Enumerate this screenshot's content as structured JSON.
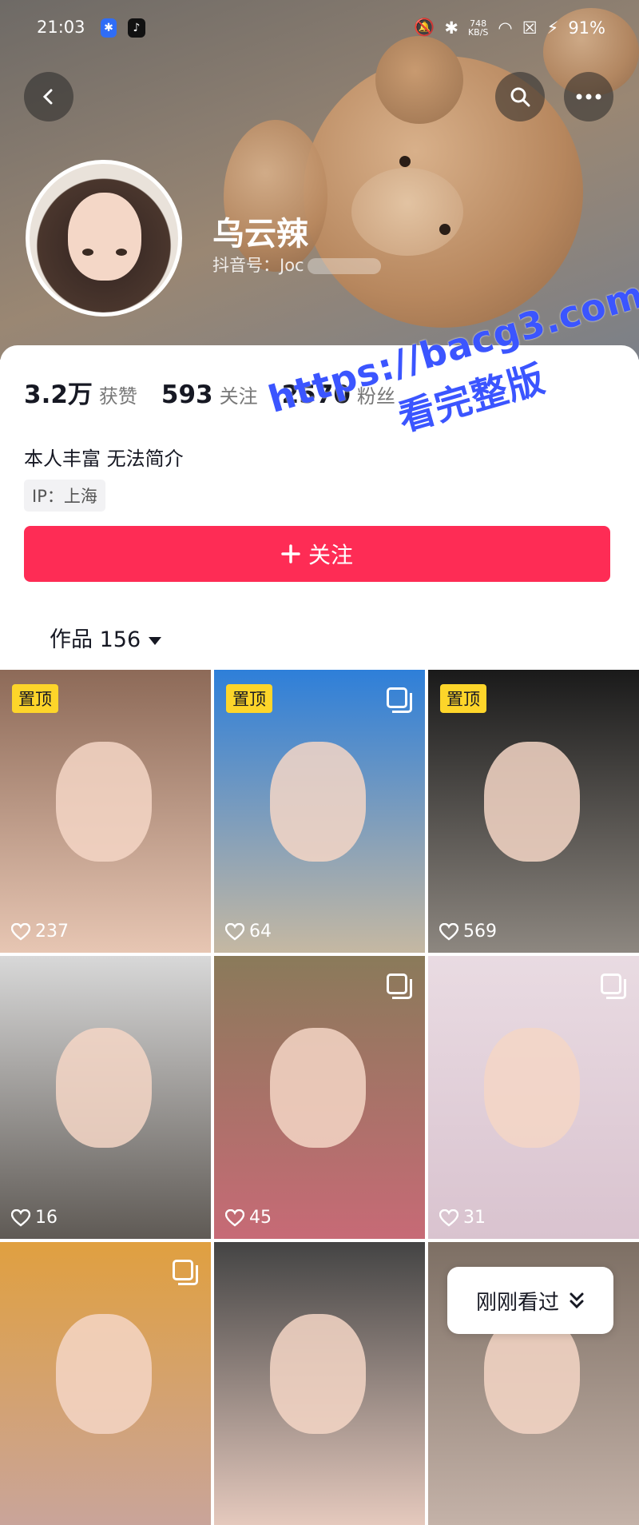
{
  "status_bar": {
    "time": "21:03",
    "net_speed_value": "748",
    "net_speed_unit": "KB/S",
    "battery": "91%"
  },
  "profile": {
    "nickname": "乌云辣",
    "douyin_id_label": "抖音号：",
    "douyin_id_visible": "Joc",
    "stats": [
      {
        "value": "3.2万",
        "label": "获赞"
      },
      {
        "value": "593",
        "label": "关注"
      },
      {
        "value": "2570",
        "label": "粉丝"
      }
    ],
    "bio": "本人丰富 无法简介",
    "ip": "IP：上海",
    "follow_label": "关注"
  },
  "works_tab": {
    "label": "作品 156"
  },
  "watermark": {
    "line1": "https://bacg3.com",
    "line2": "看完整版"
  },
  "videos": [
    {
      "pinned_label": "置顶",
      "likes": "237",
      "multi": false,
      "color_top": "#8d6a58",
      "color_bottom": "#e7c6b3"
    },
    {
      "pinned_label": "置顶",
      "likes": "64",
      "multi": true,
      "color_top": "#2e7fd9",
      "color_bottom": "#c5b8a2"
    },
    {
      "pinned_label": "置顶",
      "likes": "569",
      "multi": false,
      "color_top": "#1a1a1a",
      "color_bottom": "#8d8780"
    },
    {
      "pinned_label": "",
      "likes": "16",
      "multi": false,
      "color_top": "#d8d8d8",
      "color_bottom": "#5f5a55"
    },
    {
      "pinned_label": "",
      "likes": "45",
      "multi": true,
      "color_top": "#8a7a5a",
      "color_bottom": "#c76a76"
    },
    {
      "pinned_label": "",
      "likes": "31",
      "multi": true,
      "color_top": "#e9dbe2",
      "color_bottom": "#d9c3cf"
    },
    {
      "pinned_label": "",
      "likes": "",
      "multi": true,
      "color_top": "#e0a040",
      "color_bottom": "#c9a49a"
    },
    {
      "pinned_label": "",
      "likes": "",
      "multi": false,
      "color_top": "#444444",
      "color_bottom": "#e5c9bd"
    },
    {
      "pinned_label": "",
      "likes": "",
      "multi": false,
      "color_top": "#7d6f64",
      "color_bottom": "#c4b2a8"
    }
  ],
  "recent_button": {
    "label": "刚刚看过"
  },
  "colors": {
    "follow": "#fe2c55",
    "pin": "#fdd52a",
    "watermark": "#3b55ff"
  }
}
